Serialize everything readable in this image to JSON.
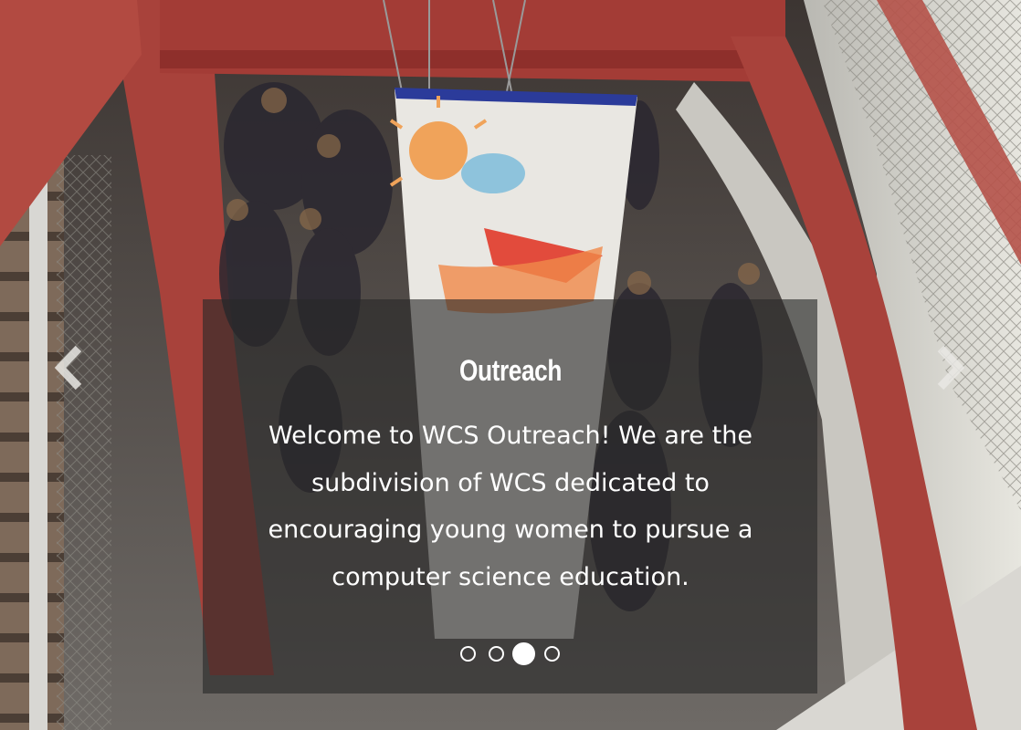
{
  "slide": {
    "title": "Outreach",
    "text": "Welcome to WCS Outreach! We are the subdivision of WCS dedicated to encouraging young women to pursue a computer science education."
  },
  "controls": {
    "prev_icon": "chevron-left-icon",
    "next_icon": "chevron-right-icon"
  },
  "indicators": {
    "count": 4,
    "active_index": 2
  },
  "colors": {
    "steel_red": "#a8423b",
    "caption_overlay": "rgba(40,40,40,0.62)",
    "text": "#ffffff"
  }
}
